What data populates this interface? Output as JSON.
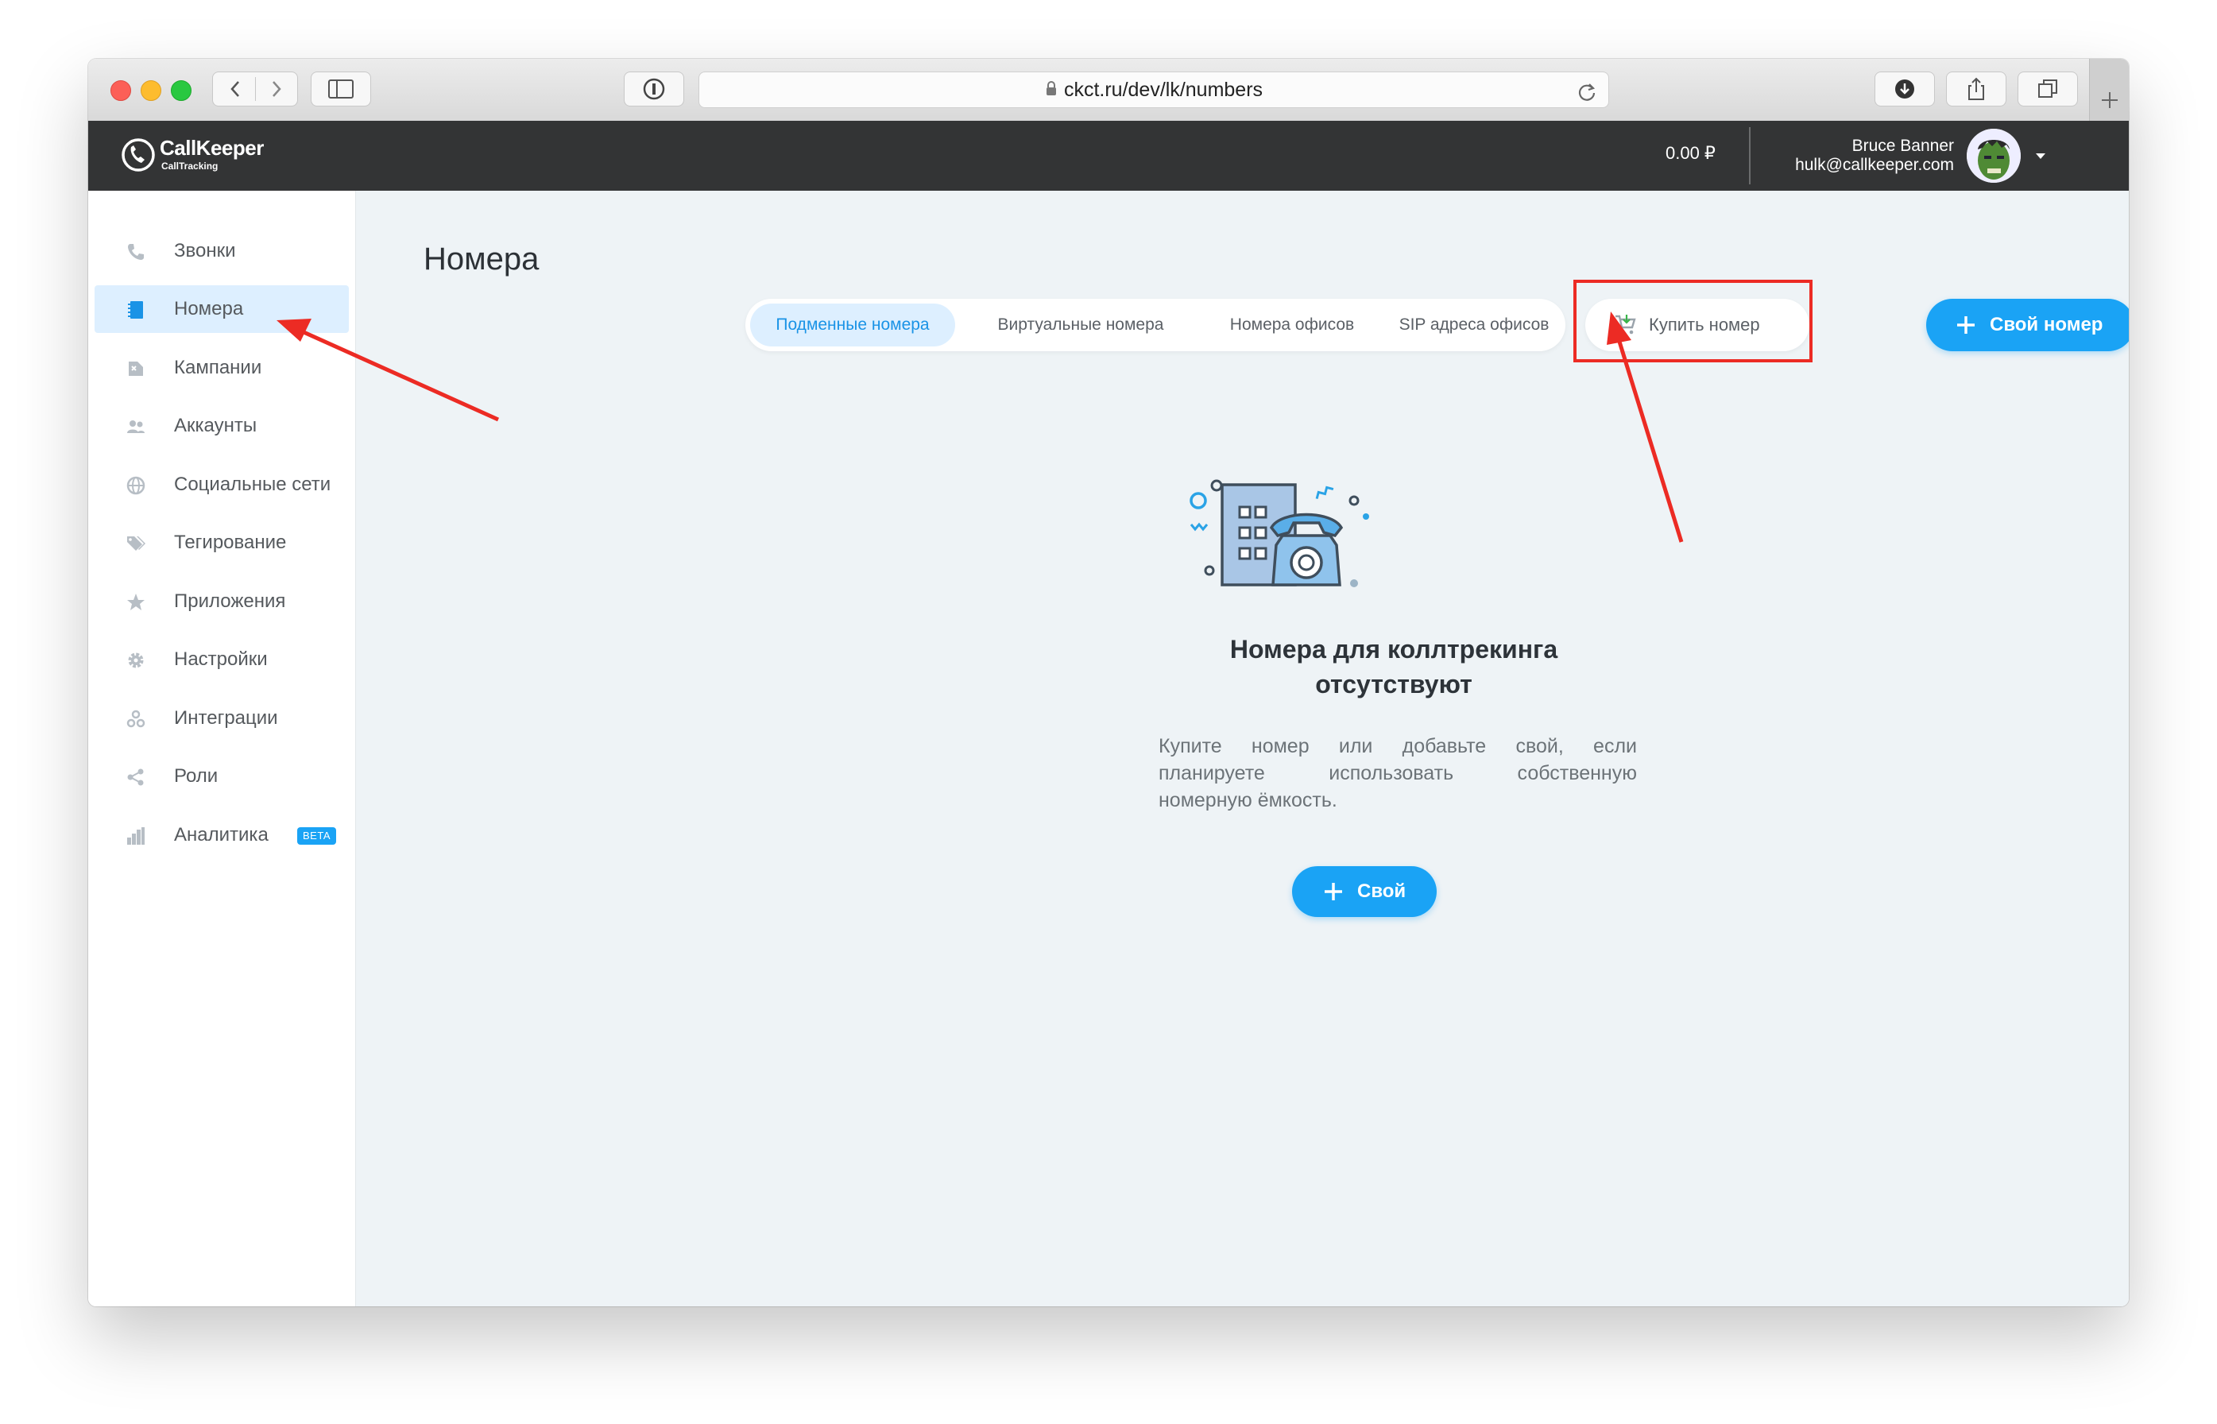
{
  "browser": {
    "url": "ckct.ru/dev/lk/numbers"
  },
  "header": {
    "logo_name": "CallKeeper",
    "logo_sub": "CallTracking",
    "balance": "0.00 ₽",
    "user_name": "Bruce Banner",
    "user_email": "hulk@callkeeper.com"
  },
  "sidebar": {
    "items": [
      {
        "label": "Звонки",
        "icon": "phone-icon"
      },
      {
        "label": "Номера",
        "icon": "numbers-book-icon",
        "active": true
      },
      {
        "label": "Кампании",
        "icon": "campaign-icon"
      },
      {
        "label": "Аккаунты",
        "icon": "accounts-icon"
      },
      {
        "label": "Социальные сети",
        "icon": "globe-icon"
      },
      {
        "label": "Тегирование",
        "icon": "tags-icon"
      },
      {
        "label": "Приложения",
        "icon": "star-icon"
      },
      {
        "label": "Настройки",
        "icon": "gear-icon"
      },
      {
        "label": "Интеграции",
        "icon": "integrations-icon"
      },
      {
        "label": "Роли",
        "icon": "share-icon"
      },
      {
        "label": "Аналитика",
        "icon": "bar-chart-icon",
        "badge": "BETA"
      }
    ]
  },
  "main": {
    "title": "Номера",
    "tabs": [
      {
        "label": "Подменные номера",
        "active": true
      },
      {
        "label": "Виртуальные номера"
      },
      {
        "label": "Номера офисов"
      },
      {
        "label": "SIP адреса офисов"
      }
    ],
    "buy_button": "Купить номер",
    "own_number_button": "Свой номер",
    "empty_title_line1": "Номера для коллтрекинга",
    "empty_title_line2": "отсутствуют",
    "empty_text_line1": "Купите номер или добавьте свой, если",
    "empty_text_line2": "планируете использовать собственную",
    "empty_text_line3": "номерную ёмкость.",
    "own_button": "Свой"
  },
  "colors": {
    "accent": "#1aa3f5",
    "annotation": "#ec2b24",
    "header_bg": "#333435",
    "main_bg": "#eef3f6"
  }
}
